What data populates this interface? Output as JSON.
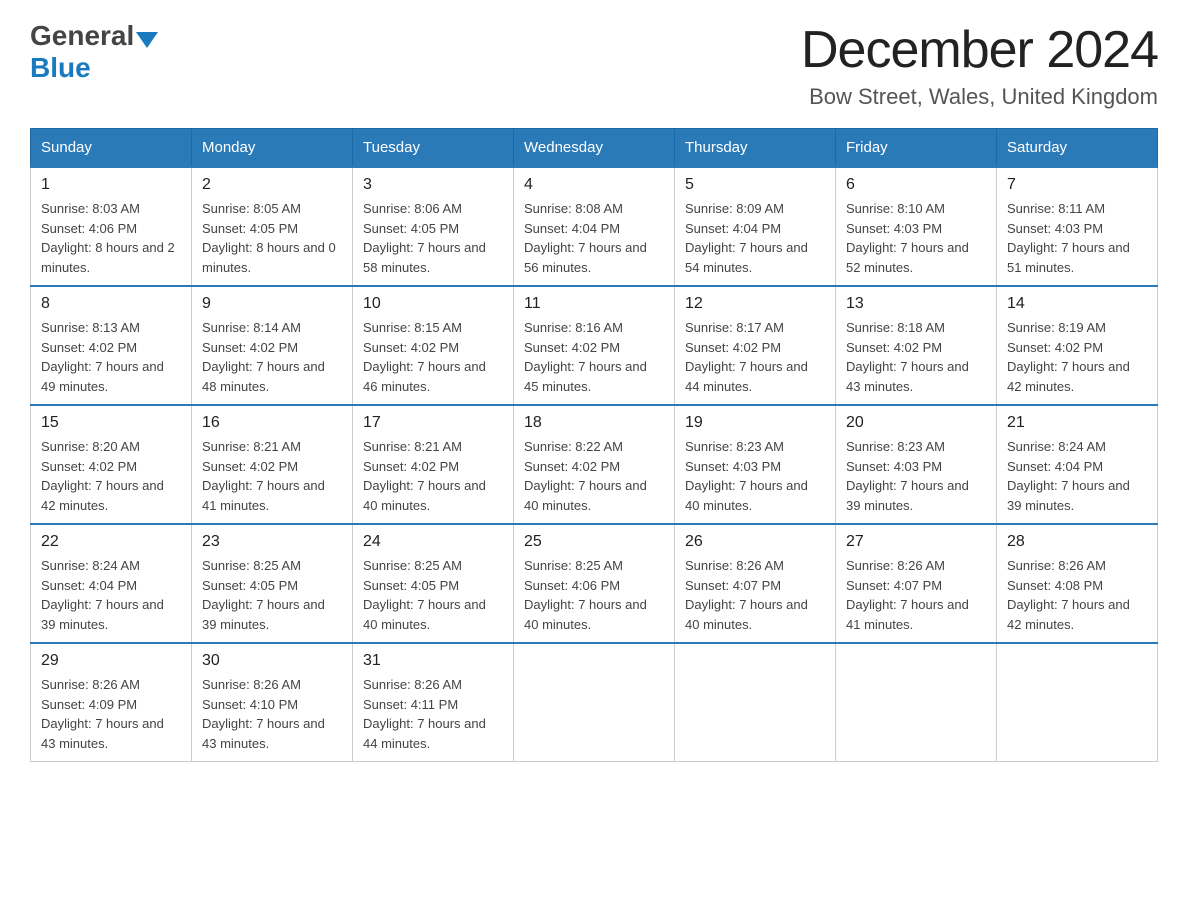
{
  "header": {
    "title": "December 2024",
    "subtitle": "Bow Street, Wales, United Kingdom",
    "logo_general": "General",
    "logo_blue": "Blue"
  },
  "days_of_week": [
    "Sunday",
    "Monday",
    "Tuesday",
    "Wednesday",
    "Thursday",
    "Friday",
    "Saturday"
  ],
  "weeks": [
    [
      {
        "day": "1",
        "sunrise": "8:03 AM",
        "sunset": "4:06 PM",
        "daylight": "8 hours and 2 minutes."
      },
      {
        "day": "2",
        "sunrise": "8:05 AM",
        "sunset": "4:05 PM",
        "daylight": "8 hours and 0 minutes."
      },
      {
        "day": "3",
        "sunrise": "8:06 AM",
        "sunset": "4:05 PM",
        "daylight": "7 hours and 58 minutes."
      },
      {
        "day": "4",
        "sunrise": "8:08 AM",
        "sunset": "4:04 PM",
        "daylight": "7 hours and 56 minutes."
      },
      {
        "day": "5",
        "sunrise": "8:09 AM",
        "sunset": "4:04 PM",
        "daylight": "7 hours and 54 minutes."
      },
      {
        "day": "6",
        "sunrise": "8:10 AM",
        "sunset": "4:03 PM",
        "daylight": "7 hours and 52 minutes."
      },
      {
        "day": "7",
        "sunrise": "8:11 AM",
        "sunset": "4:03 PM",
        "daylight": "7 hours and 51 minutes."
      }
    ],
    [
      {
        "day": "8",
        "sunrise": "8:13 AM",
        "sunset": "4:02 PM",
        "daylight": "7 hours and 49 minutes."
      },
      {
        "day": "9",
        "sunrise": "8:14 AM",
        "sunset": "4:02 PM",
        "daylight": "7 hours and 48 minutes."
      },
      {
        "day": "10",
        "sunrise": "8:15 AM",
        "sunset": "4:02 PM",
        "daylight": "7 hours and 46 minutes."
      },
      {
        "day": "11",
        "sunrise": "8:16 AM",
        "sunset": "4:02 PM",
        "daylight": "7 hours and 45 minutes."
      },
      {
        "day": "12",
        "sunrise": "8:17 AM",
        "sunset": "4:02 PM",
        "daylight": "7 hours and 44 minutes."
      },
      {
        "day": "13",
        "sunrise": "8:18 AM",
        "sunset": "4:02 PM",
        "daylight": "7 hours and 43 minutes."
      },
      {
        "day": "14",
        "sunrise": "8:19 AM",
        "sunset": "4:02 PM",
        "daylight": "7 hours and 42 minutes."
      }
    ],
    [
      {
        "day": "15",
        "sunrise": "8:20 AM",
        "sunset": "4:02 PM",
        "daylight": "7 hours and 42 minutes."
      },
      {
        "day": "16",
        "sunrise": "8:21 AM",
        "sunset": "4:02 PM",
        "daylight": "7 hours and 41 minutes."
      },
      {
        "day": "17",
        "sunrise": "8:21 AM",
        "sunset": "4:02 PM",
        "daylight": "7 hours and 40 minutes."
      },
      {
        "day": "18",
        "sunrise": "8:22 AM",
        "sunset": "4:02 PM",
        "daylight": "7 hours and 40 minutes."
      },
      {
        "day": "19",
        "sunrise": "8:23 AM",
        "sunset": "4:03 PM",
        "daylight": "7 hours and 40 minutes."
      },
      {
        "day": "20",
        "sunrise": "8:23 AM",
        "sunset": "4:03 PM",
        "daylight": "7 hours and 39 minutes."
      },
      {
        "day": "21",
        "sunrise": "8:24 AM",
        "sunset": "4:04 PM",
        "daylight": "7 hours and 39 minutes."
      }
    ],
    [
      {
        "day": "22",
        "sunrise": "8:24 AM",
        "sunset": "4:04 PM",
        "daylight": "7 hours and 39 minutes."
      },
      {
        "day": "23",
        "sunrise": "8:25 AM",
        "sunset": "4:05 PM",
        "daylight": "7 hours and 39 minutes."
      },
      {
        "day": "24",
        "sunrise": "8:25 AM",
        "sunset": "4:05 PM",
        "daylight": "7 hours and 40 minutes."
      },
      {
        "day": "25",
        "sunrise": "8:25 AM",
        "sunset": "4:06 PM",
        "daylight": "7 hours and 40 minutes."
      },
      {
        "day": "26",
        "sunrise": "8:26 AM",
        "sunset": "4:07 PM",
        "daylight": "7 hours and 40 minutes."
      },
      {
        "day": "27",
        "sunrise": "8:26 AM",
        "sunset": "4:07 PM",
        "daylight": "7 hours and 41 minutes."
      },
      {
        "day": "28",
        "sunrise": "8:26 AM",
        "sunset": "4:08 PM",
        "daylight": "7 hours and 42 minutes."
      }
    ],
    [
      {
        "day": "29",
        "sunrise": "8:26 AM",
        "sunset": "4:09 PM",
        "daylight": "7 hours and 43 minutes."
      },
      {
        "day": "30",
        "sunrise": "8:26 AM",
        "sunset": "4:10 PM",
        "daylight": "7 hours and 43 minutes."
      },
      {
        "day": "31",
        "sunrise": "8:26 AM",
        "sunset": "4:11 PM",
        "daylight": "7 hours and 44 minutes."
      },
      null,
      null,
      null,
      null
    ]
  ]
}
